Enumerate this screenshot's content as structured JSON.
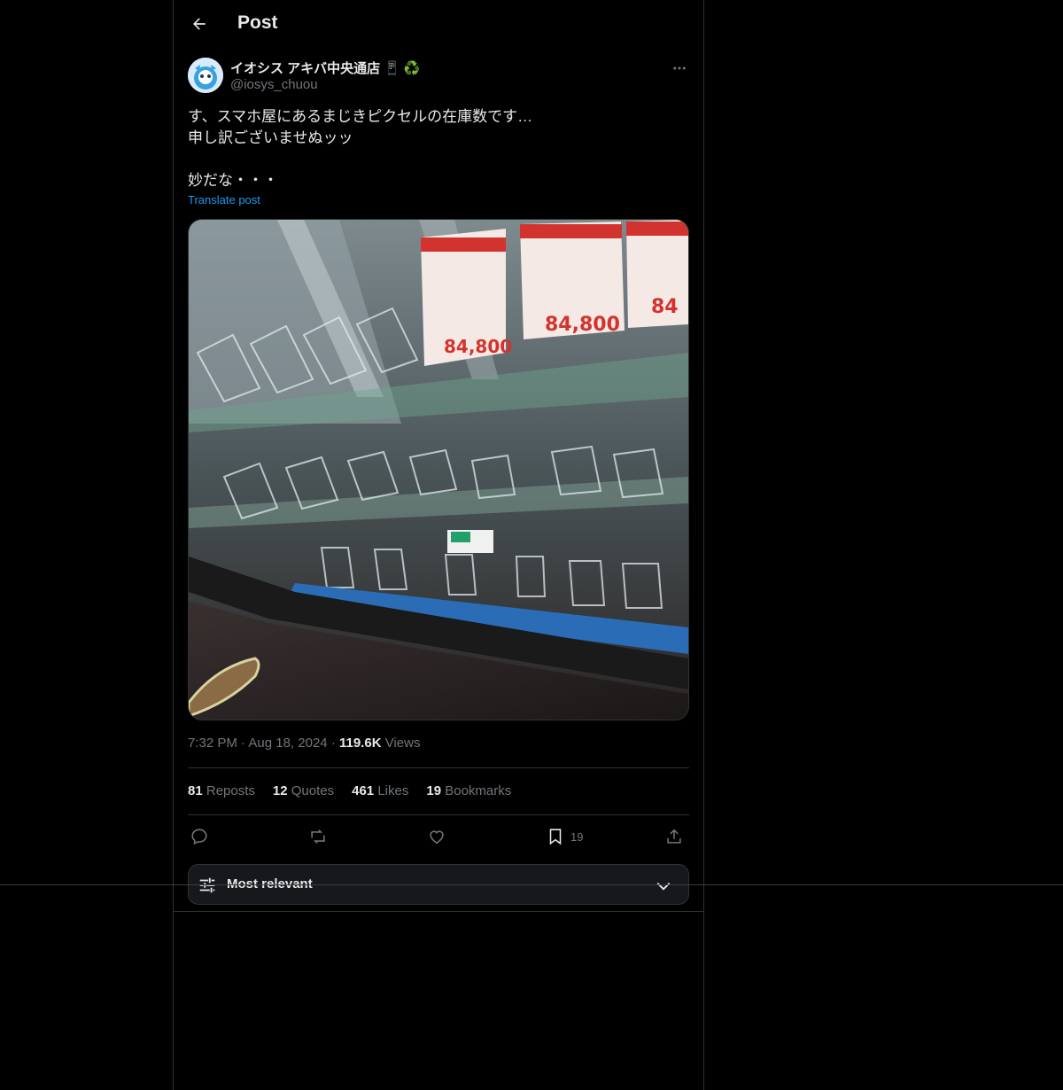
{
  "header": {
    "title": "Post"
  },
  "post": {
    "author": {
      "display_name": "イオシス アキバ中央通店",
      "emoji_1": "📱",
      "emoji_2": "♻️",
      "handle": "@iosys_chuou"
    },
    "text_lines": [
      "す、スマホ屋にあるまじきピクセルの在庫数です…",
      "申し訳ございませぬッッ",
      "",
      "妙だな・・・"
    ],
    "translate_label": "Translate post",
    "meta": {
      "time": "7:32 PM",
      "date": "Aug 18, 2024",
      "views_count": "119.6K",
      "views_label": "Views",
      "separator": "·"
    },
    "stats": [
      {
        "count": "81",
        "label": "Reposts"
      },
      {
        "count": "12",
        "label": "Quotes"
      },
      {
        "count": "461",
        "label": "Likes"
      },
      {
        "count": "19",
        "label": "Bookmarks"
      }
    ],
    "actions": {
      "reply_icon": "reply-icon",
      "repost_icon": "repost-icon",
      "like_icon": "heart-icon",
      "bookmark_icon": "bookmark-icon",
      "bookmark_count": "19",
      "share_icon": "share-icon"
    },
    "media_description_icon": "photo-empty-phone-display-case",
    "price_tags": [
      "84,800",
      "84,800",
      "84"
    ]
  },
  "replies_sort": {
    "label": "Most relevant"
  },
  "colors": {
    "background": "#000000",
    "text": "#e7e9ea",
    "muted": "#71767b",
    "accent": "#1d9bf0",
    "border": "#2f3336"
  }
}
